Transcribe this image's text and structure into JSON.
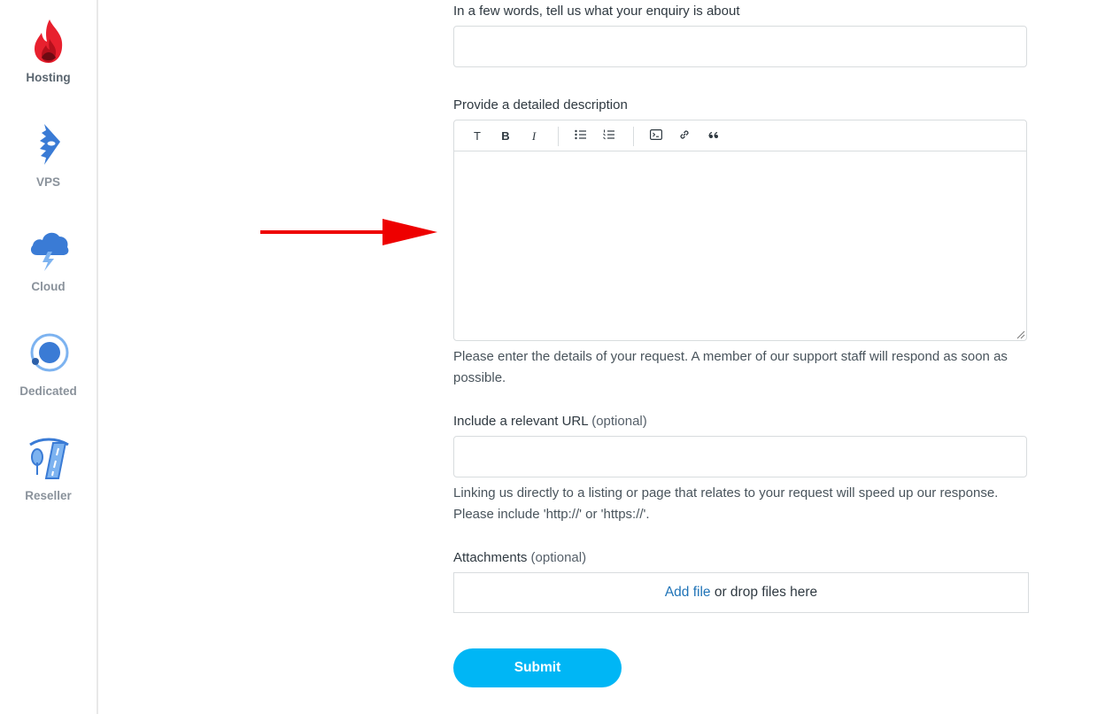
{
  "sidebar": {
    "items": [
      {
        "label": "Hosting",
        "icon": "flame-icon"
      },
      {
        "label": "VPS",
        "icon": "vps-icon"
      },
      {
        "label": "Cloud",
        "icon": "cloud-icon"
      },
      {
        "label": "Dedicated",
        "icon": "dedicated-server-icon"
      },
      {
        "label": "Reseller",
        "icon": "reseller-road-icon"
      }
    ]
  },
  "form": {
    "subject": {
      "label": "In a few words, tell us what your enquiry is about",
      "value": ""
    },
    "description": {
      "label": "Provide a detailed description",
      "value": "",
      "hint": "Please enter the details of your request. A member of our support staff will respond as soon as possible.",
      "toolbar": {
        "text": "T",
        "bold": "B",
        "italic": "I"
      }
    },
    "url": {
      "label": "Include a relevant URL",
      "optional": "(optional)",
      "value": "",
      "hint": "Linking us directly to a listing or page that relates to your request will speed up our response. Please include 'http://' or 'https://'."
    },
    "attachments": {
      "label": "Attachments",
      "optional": "(optional)",
      "add_file": "Add file",
      "drop_text": " or drop files here"
    },
    "submit_label": "Submit"
  },
  "colors": {
    "accent": "#00b6f5",
    "link": "#1f73b7",
    "arrow": "#ee0000",
    "icon_blue": "#3a7bd5"
  }
}
